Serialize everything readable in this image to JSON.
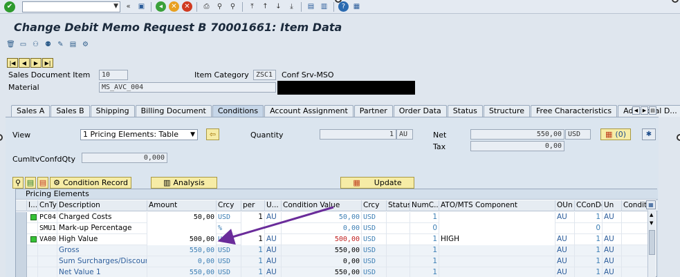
{
  "toolbar": {
    "command_field": ""
  },
  "title": "Change Debit Memo Request B 70001661: Item Data",
  "header": {
    "sales_doc_item_label": "Sales Document Item",
    "sales_doc_item_value": "10",
    "item_category_label": "Item Category",
    "item_category_value": "ZSC1",
    "item_category_desc": "Conf Srv-MSO",
    "material_label": "Material",
    "material_value": "MS_AVC_004"
  },
  "tabs": [
    "Sales A",
    "Sales B",
    "Shipping",
    "Billing Document",
    "Conditions",
    "Account Assignment",
    "Partner",
    "Order Data",
    "Status",
    "Structure",
    "Free Characteristics",
    "Additional D..."
  ],
  "active_tab": "Conditions",
  "conditions": {
    "view_label": "View",
    "view_value": "1 Pricing Elements: Table",
    "quantity_label": "Quantity",
    "quantity_value": "1",
    "quantity_unit": "AU",
    "net_label": "Net",
    "net_value": "550,00",
    "net_currency": "USD",
    "net_button": "(0)",
    "tax_label": "Tax",
    "tax_value": "0,00",
    "cumltv_label": "CumltvConfdQty",
    "cumltv_value": "0,000",
    "condition_record_button": "Condition Record",
    "analysis_button": "Analysis",
    "update_button": "Update"
  },
  "grid": {
    "title": "Pricing Elements",
    "columns": [
      "I...",
      "CnTy",
      "Description",
      "Amount",
      "Crcy",
      "per",
      "U...",
      "Condition Value",
      "Crcy",
      "Status",
      "NumC...",
      "ATO/MTS Component",
      "OUn",
      "CConDe",
      "Un",
      "Conditi"
    ],
    "rows": [
      {
        "status_icon": true,
        "cnty": "PC04",
        "desc": "Charged Costs",
        "amount": "50,00",
        "crcy": "USD",
        "per": "1",
        "u": "AU",
        "cond_value": "50,00",
        "crcy2": "USD",
        "numc": "1",
        "ato": "",
        "oun": "AU",
        "cconde": "1",
        "un": "AU",
        "sub": false
      },
      {
        "status_icon": false,
        "cnty": "SMU1",
        "desc": "Mark-up Percentage",
        "amount": "",
        "crcy": "%",
        "per": "",
        "u": "",
        "cond_value": "0,00",
        "crcy2": "USD",
        "numc": "0",
        "ato": "",
        "oun": "",
        "cconde": "0",
        "un": "",
        "sub": false
      },
      {
        "status_icon": true,
        "cnty": "VA00",
        "desc": "High Value",
        "amount": "500,00",
        "crcy": "USD",
        "per": "1",
        "u": "AU",
        "cond_value": "500,00",
        "crcy2": "USD",
        "numc": "1",
        "ato": "HIGH",
        "oun": "AU",
        "cconde": "1",
        "un": "AU",
        "sub": false
      },
      {
        "status_icon": false,
        "cnty": "",
        "desc": "Gross",
        "amount": "550,00",
        "crcy": "USD",
        "per": "1",
        "u": "AU",
        "cond_value": "550,00",
        "crcy2": "USD",
        "numc": "1",
        "ato": "",
        "oun": "AU",
        "cconde": "1",
        "un": "AU",
        "sub": true
      },
      {
        "status_icon": false,
        "cnty": "",
        "desc": "Sum Surcharges/Discounts",
        "amount": "0,00",
        "crcy": "USD",
        "per": "1",
        "u": "AU",
        "cond_value": "0,00",
        "crcy2": "USD",
        "numc": "1",
        "ato": "",
        "oun": "AU",
        "cconde": "1",
        "un": "AU",
        "sub": true
      },
      {
        "status_icon": false,
        "cnty": "",
        "desc": "Net Value 1",
        "amount": "550,00",
        "crcy": "USD",
        "per": "1",
        "u": "AU",
        "cond_value": "550,00",
        "crcy2": "USD",
        "numc": "1",
        "ato": "",
        "oun": "AU",
        "cconde": "1",
        "un": "AU",
        "sub": true
      }
    ]
  },
  "colors": {
    "annotation_arrow": "#6a2c9a"
  }
}
